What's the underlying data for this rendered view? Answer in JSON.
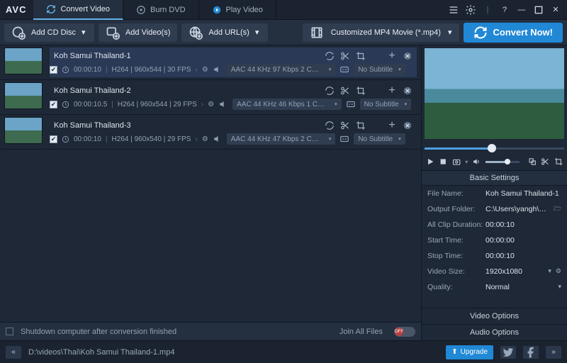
{
  "app": {
    "name": "AVC"
  },
  "tabs": [
    {
      "label": "Convert Video",
      "active": true
    },
    {
      "label": "Burn DVD",
      "active": false
    },
    {
      "label": "Play Video",
      "active": false
    }
  ],
  "toolbar": {
    "add_cd": "Add CD Disc",
    "add_videos": "Add Video(s)",
    "add_urls": "Add URL(s)",
    "profile": "Customized MP4 Movie (*.mp4)",
    "convert": "Convert Now!"
  },
  "items": [
    {
      "title": "Koh Samui Thailand-1",
      "duration": "00:00:10",
      "vinfo": "H264 | 960x544 | 30 FPS",
      "audio": "AAC 44 KHz 97 Kbps 2 CH ...",
      "subtitle": "No Subtitle",
      "selected": true
    },
    {
      "title": "Koh Samui Thailand-2",
      "duration": "00:00:10.5",
      "vinfo": "H264 | 960x544 | 29 FPS",
      "audio": "AAC 44 KHz 46 Kbps 1 CH ...",
      "subtitle": "No Subtitle",
      "selected": false
    },
    {
      "title": "Koh Samui Thailand-3",
      "duration": "00:00:10",
      "vinfo": "H264 | 960x540 | 29 FPS",
      "audio": "AAC 44 KHz 47 Kbps 2 CH ...",
      "subtitle": "No Subtitle",
      "selected": false
    }
  ],
  "bottombar": {
    "shutdown": "Shutdown computer after conversion finished",
    "join": "Join All Files",
    "toggle": "OFF"
  },
  "basic": {
    "title": "Basic Settings",
    "rows": {
      "filename_l": "File Name:",
      "filename_v": "Koh Samui Thailand-1",
      "output_l": "Output Folder:",
      "output_v": "C:\\Users\\yangh\\Videos...",
      "clipdur_l": "All Clip Duration:",
      "clipdur_v": "00:00:10",
      "start_l": "Start Time:",
      "start_v": "00:00:00",
      "stop_l": "Stop Time:",
      "stop_v": "00:00:10",
      "vsize_l": "Video Size:",
      "vsize_v": "1920x1080",
      "quality_l": "Quality:",
      "quality_v": "Normal"
    }
  },
  "side": {
    "video_options": "Video Options",
    "audio_options": "Audio Options"
  },
  "status": {
    "path": "D:\\videos\\Thai\\Koh Samui Thailand-1.mp4",
    "upgrade": "Upgrade"
  }
}
